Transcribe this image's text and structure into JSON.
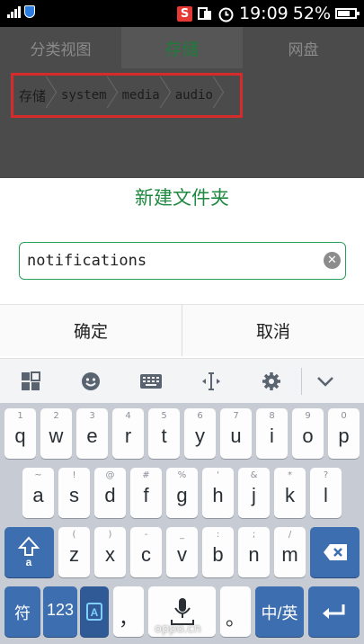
{
  "status_bar": {
    "time": "19:09",
    "battery": "52%",
    "icons": [
      "signal-icon",
      "shield-icon",
      "s-app-icon",
      "sync-icon",
      "alarm-icon",
      "battery-icon"
    ]
  },
  "tabs": [
    {
      "label": "分类视图",
      "active": false
    },
    {
      "label": "存储",
      "active": true
    },
    {
      "label": "网盘",
      "active": false
    }
  ],
  "breadcrumb": [
    "存储",
    "system",
    "media",
    "audio"
  ],
  "dialog": {
    "title": "新建文件夹",
    "input_value": "notifications",
    "confirm_label": "确定",
    "cancel_label": "取消"
  },
  "keyboard": {
    "row1": [
      [
        "1",
        "q"
      ],
      [
        "2",
        "w"
      ],
      [
        "3",
        "e"
      ],
      [
        "4",
        "r"
      ],
      [
        "5",
        "t"
      ],
      [
        "6",
        "y"
      ],
      [
        "7",
        "u"
      ],
      [
        "8",
        "i"
      ],
      [
        "9",
        "o"
      ],
      [
        "0",
        "p"
      ]
    ],
    "row2": [
      [
        "~",
        "a"
      ],
      [
        "!",
        "s"
      ],
      [
        "@",
        "d"
      ],
      [
        "#",
        "f"
      ],
      [
        "%",
        "g"
      ],
      [
        "'",
        "h"
      ],
      [
        "&",
        "j"
      ],
      [
        "*",
        "k"
      ],
      [
        "?",
        "l"
      ]
    ],
    "row3": [
      [
        "(",
        "z"
      ],
      [
        ")",
        "x"
      ],
      [
        "-",
        "c"
      ],
      [
        "_",
        "v"
      ],
      [
        ":",
        "b"
      ],
      [
        ";",
        "n"
      ],
      [
        "/",
        "m"
      ]
    ],
    "bottom": {
      "symbol": "符",
      "num": "123",
      "comma": "，",
      "period": "。",
      "lang": "中/英"
    },
    "toolbar_icons": [
      "apps-icon",
      "emoji-icon",
      "keyboard-icon",
      "cursor-icon",
      "gear-icon",
      "chevron-down-icon"
    ]
  },
  "watermark": "oppo.cn"
}
